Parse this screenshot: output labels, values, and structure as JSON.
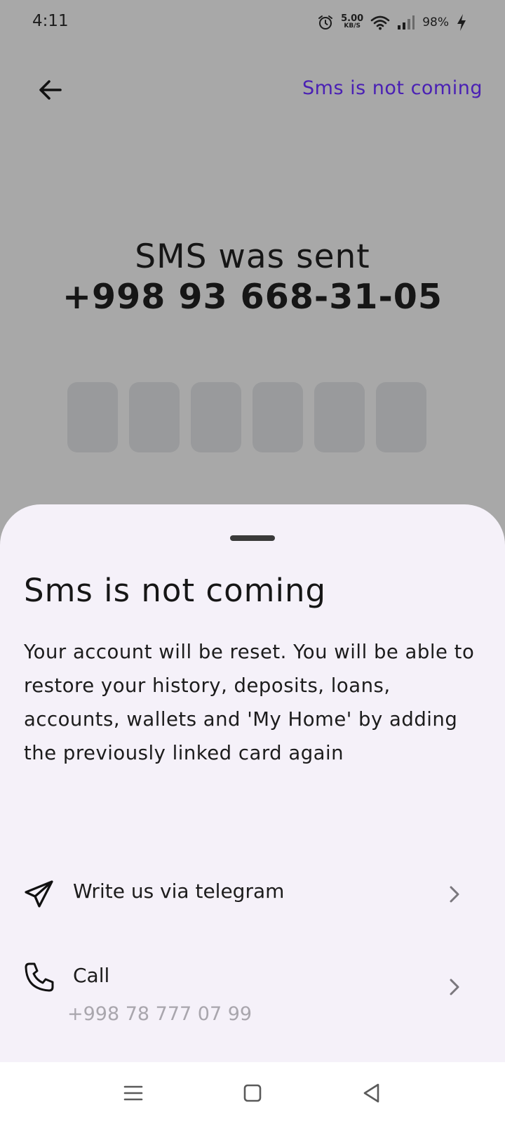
{
  "status_bar": {
    "time": "4:11",
    "net_speed_value": "5.00",
    "net_speed_unit": "KB/S",
    "battery": "98%",
    "icons": [
      "alarm-icon",
      "wifi-icon",
      "signal-icon",
      "charging-icon"
    ]
  },
  "header": {
    "back_icon": "arrow-left-icon",
    "sms_not_coming_link": "Sms is not coming"
  },
  "verification": {
    "title": "SMS was sent",
    "phone": "+998 93 668-31-05",
    "code_boxes": [
      "",
      "",
      "",
      "",
      "",
      ""
    ]
  },
  "sheet": {
    "title": "Sms is not coming",
    "description": "Your account will be reset. You will be able to restore your history, deposits, loans, accounts, wallets and 'My Home' by adding the previously linked card again",
    "options": [
      {
        "icon": "telegram-icon",
        "label": "Write us via telegram"
      },
      {
        "icon": "phone-icon",
        "label": "Call",
        "sublabel": "+998 78 777 07 99"
      }
    ]
  },
  "nav_bar": {
    "buttons": [
      "menu-icon",
      "home-icon",
      "back-icon"
    ]
  },
  "colors": {
    "accent": "#4a20b4",
    "scrim": "#a8a8a8",
    "sheet_background": "#f5f1f9",
    "code_box": "#999a9c",
    "muted_text": "#a9a6ad"
  }
}
